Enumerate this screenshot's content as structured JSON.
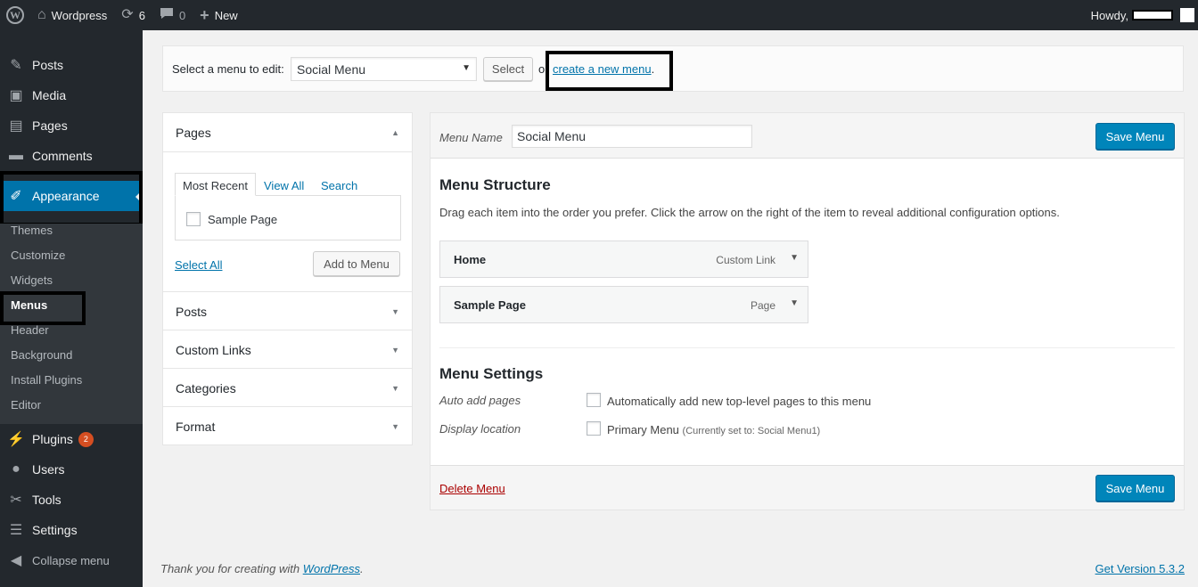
{
  "adminbar": {
    "site_name": "Wordpress",
    "updates_count": "6",
    "comments_count": "0",
    "new_label": "New",
    "howdy": "Howdy,"
  },
  "sidebar": {
    "items": {
      "posts": "Posts",
      "media": "Media",
      "pages": "Pages",
      "comments": "Comments",
      "appearance": "Appearance",
      "plugins": "Plugins",
      "plugins_badge": "2",
      "users": "Users",
      "tools": "Tools",
      "settings": "Settings",
      "collapse": "Collapse menu"
    },
    "submenu": {
      "themes": "Themes",
      "customize": "Customize",
      "widgets": "Widgets",
      "menus": "Menus",
      "header": "Header",
      "background": "Background",
      "install_plugins": "Install Plugins",
      "editor": "Editor"
    }
  },
  "select_bar": {
    "label": "Select a menu to edit:",
    "selected_menu": "Social Menu",
    "select_button": "Select",
    "or_text": "or",
    "create_link": "create a new menu",
    "period": "."
  },
  "accordion": {
    "pages_title": "Pages",
    "tabs": {
      "most_recent": "Most Recent",
      "view_all": "View All",
      "search": "Search"
    },
    "sample_page": "Sample Page",
    "select_all": "Select All",
    "add_to_menu": "Add to Menu",
    "sections": {
      "posts": "Posts",
      "custom_links": "Custom Links",
      "categories": "Categories",
      "format": "Format"
    }
  },
  "editor": {
    "menu_name_label": "Menu Name",
    "menu_name_value": "Social Menu",
    "save_menu": "Save Menu",
    "structure_title": "Menu Structure",
    "structure_desc": "Drag each item into the order you prefer. Click the arrow on the right of the item to reveal additional configuration options.",
    "items": [
      {
        "title": "Home",
        "type": "Custom Link"
      },
      {
        "title": "Sample Page",
        "type": "Page"
      }
    ],
    "settings_title": "Menu Settings",
    "auto_add_label": "Auto add pages",
    "auto_add_text": "Automatically add new top-level pages to this menu",
    "display_location_label": "Display location",
    "primary_menu": "Primary Menu",
    "currently_set": "(Currently set to: Social Menu1)",
    "delete_menu": "Delete Menu"
  },
  "footer": {
    "thanks_prefix": "Thank you for creating with ",
    "wordpress_link": "WordPress",
    "thanks_suffix": ".",
    "version_link": "Get Version 5.3.2"
  },
  "colors": {
    "admin_dark": "#23282d",
    "submenu_bg": "#32373c",
    "accent_blue": "#0073aa",
    "primary_button": "#0085ba",
    "badge": "#d54e21",
    "delete_red": "#aa0000"
  }
}
